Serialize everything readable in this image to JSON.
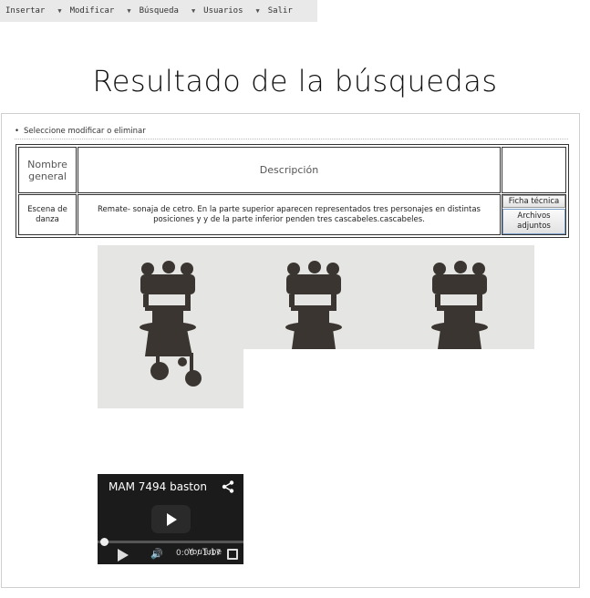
{
  "menu": {
    "items": [
      {
        "label": "Insertar"
      },
      {
        "label": "Modificar"
      },
      {
        "label": "Búsqueda"
      },
      {
        "label": "Usuarios"
      },
      {
        "label": "Salir"
      }
    ]
  },
  "page": {
    "title": "Resultado de la búsquedas"
  },
  "results": {
    "hint": "Seleccione modificar o eliminar",
    "headers": {
      "name": "Nombre general",
      "description": "Descripción",
      "actions": ""
    },
    "rows": [
      {
        "name": "Escena de danza",
        "description": "Remate- sonaja de cetro. En la parte superior aparecen representados tres personajes en distintas posiciones y y de la parte inferior penden tres cascabeles.cascabeles.",
        "tech_button": "Ficha técnica",
        "files_button": "Archivos adjuntos"
      }
    ]
  },
  "video": {
    "title": "MAM 7494 baston",
    "time": "0:00 / 1:17",
    "logo": "YouTube",
    "share_icon": "share-icon",
    "play_icon": "play-icon"
  },
  "colors": {
    "menubar_bg": "#e9e9e9",
    "photo_bg": "#e5e5e3",
    "bronze": "#3a3530"
  }
}
